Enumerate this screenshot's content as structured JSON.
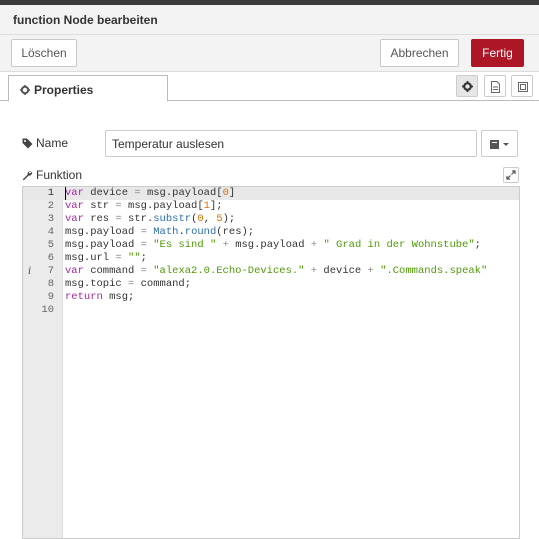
{
  "tray": {
    "title": "function Node bearbeiten"
  },
  "toolbar": {
    "delete_label": "Löschen",
    "cancel_label": "Abbrechen",
    "done_label": "Fertig"
  },
  "tabs": {
    "properties_label": "Properties"
  },
  "form": {
    "name_label": "Name",
    "name_value": "Temperatur auslesen",
    "function_label": "Funktion"
  },
  "editor": {
    "active_line": 1,
    "lines": [
      {
        "n": "1",
        "code": [
          [
            "k",
            "var"
          ],
          [
            "t",
            " device "
          ],
          [
            "o",
            "="
          ],
          [
            "t",
            " msg.payload["
          ],
          [
            "n",
            "0"
          ],
          [
            "t",
            "]"
          ]
        ]
      },
      {
        "n": "2",
        "code": [
          [
            "k",
            "var"
          ],
          [
            "t",
            " str "
          ],
          [
            "o",
            "="
          ],
          [
            "t",
            " msg.payload["
          ],
          [
            "n",
            "1"
          ],
          [
            "t",
            "];"
          ]
        ]
      },
      {
        "n": "3",
        "code": [
          [
            "k",
            "var"
          ],
          [
            "t",
            " res "
          ],
          [
            "o",
            "="
          ],
          [
            "t",
            " str."
          ],
          [
            "f",
            "substr"
          ],
          [
            "t",
            "("
          ],
          [
            "n",
            "0"
          ],
          [
            "t",
            ", "
          ],
          [
            "n",
            "5"
          ],
          [
            "t",
            ");"
          ]
        ]
      },
      {
        "n": "4",
        "code": [
          [
            "t",
            "msg.payload "
          ],
          [
            "o",
            "="
          ],
          [
            "t",
            " "
          ],
          [
            "f",
            "Math"
          ],
          [
            "t",
            "."
          ],
          [
            "f",
            "round"
          ],
          [
            "t",
            "(res);"
          ]
        ]
      },
      {
        "n": "5",
        "code": [
          [
            "t",
            "msg.payload "
          ],
          [
            "o",
            "="
          ],
          [
            "t",
            " "
          ],
          [
            "s",
            "\"Es sind \""
          ],
          [
            "t",
            " "
          ],
          [
            "o",
            "+"
          ],
          [
            "t",
            " msg.payload "
          ],
          [
            "o",
            "+"
          ],
          [
            "t",
            " "
          ],
          [
            "s",
            "\" Grad in der Wohnstube\""
          ],
          [
            "t",
            ";"
          ]
        ]
      },
      {
        "n": "6",
        "code": [
          [
            "t",
            "msg.url "
          ],
          [
            "o",
            "="
          ],
          [
            "t",
            " "
          ],
          [
            "s",
            "\"\""
          ],
          [
            "t",
            ";"
          ]
        ]
      },
      {
        "n": "7",
        "info": "i",
        "code": [
          [
            "k",
            "var"
          ],
          [
            "t",
            " command "
          ],
          [
            "o",
            "="
          ],
          [
            "t",
            " "
          ],
          [
            "s",
            "\"alexa2.0.Echo-Devices.\""
          ],
          [
            "t",
            " "
          ],
          [
            "o",
            "+"
          ],
          [
            "t",
            " device "
          ],
          [
            "o",
            "+"
          ],
          [
            "t",
            " "
          ],
          [
            "s",
            "\".Commands.speak\""
          ]
        ]
      },
      {
        "n": "8",
        "code": [
          [
            "t",
            "msg.topic "
          ],
          [
            "o",
            "="
          ],
          [
            "t",
            " command;"
          ]
        ]
      },
      {
        "n": "9",
        "code": [
          [
            "k",
            "return"
          ],
          [
            "t",
            " msg;"
          ]
        ]
      },
      {
        "n": "10",
        "code": []
      }
    ]
  },
  "icons": {
    "tab_gear": "gear-icon",
    "settings_tab": "gear-icon",
    "description_tab": "file-icon",
    "appearance_tab": "frame-icon",
    "name": "tag-icon",
    "function": "wrench-icon",
    "icon_select": "book-icon",
    "expand": "expand-icon"
  },
  "colors": {
    "accent": "#ad1625",
    "keyword": "#a626a4",
    "string": "#4e9a06",
    "number": "#d97000",
    "function": "#2a6fb0"
  }
}
